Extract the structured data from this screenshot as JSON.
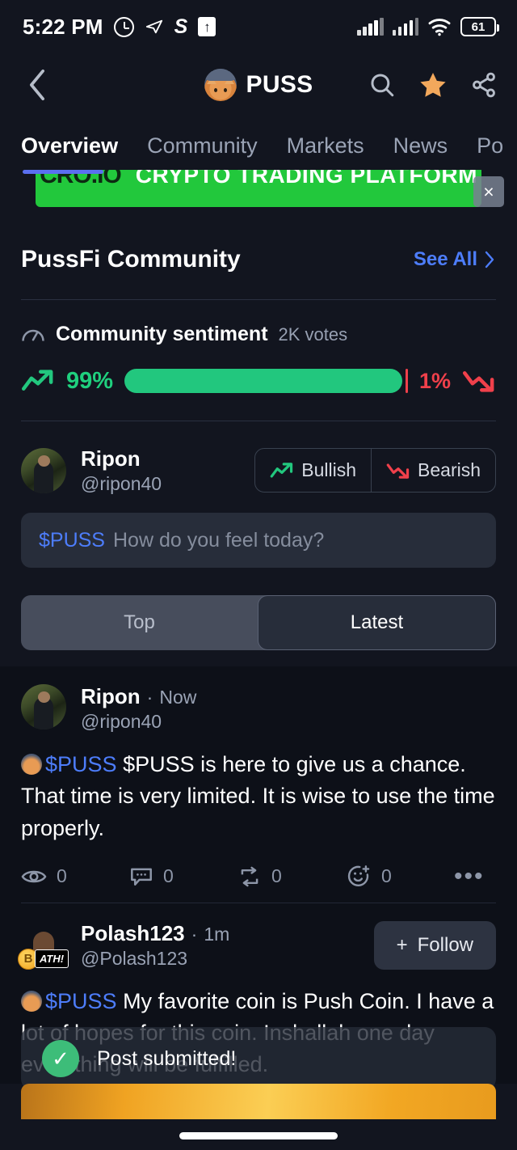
{
  "status_bar": {
    "time": "5:22 PM",
    "battery_level": "61",
    "icons": [
      "alarm-icon",
      "telegram-icon",
      "s-app-icon",
      "upload-icon",
      "signal-icon",
      "signal-icon",
      "wifi-icon",
      "battery-icon"
    ]
  },
  "header": {
    "back_icon": "chevron-left-icon",
    "coin_symbol": "PUSS",
    "avatar_icon": "puss-cat-avatar",
    "search_icon": "search-icon",
    "favorite_icon": "star-filled-icon",
    "share_icon": "share-icon",
    "favorite_color": "#f2a85c"
  },
  "tabs": [
    {
      "label": "Overview",
      "active": true
    },
    {
      "label": "Community",
      "active": false
    },
    {
      "label": "Markets",
      "active": false
    },
    {
      "label": "News",
      "active": false
    },
    {
      "label": "Po",
      "active": false
    }
  ],
  "ad": {
    "logo": "CRO.IO",
    "text": "CRYPTO TRADING PLATFORM",
    "close_label": "×",
    "background": "#22c83c"
  },
  "community": {
    "title": "PussFi Community",
    "see_all": "See All",
    "see_all_chevron": "›",
    "sentiment": {
      "label": "Community sentiment",
      "votes": "2K votes",
      "bullish_pct": "99%",
      "bearish_pct": "1%",
      "bullish_value": 99,
      "bearish_value": 1,
      "bullish_color": "#22c77e",
      "bearish_color": "#f0404b"
    }
  },
  "composer": {
    "user_name": "Ripon",
    "user_handle": "@ripon40",
    "bullish_label": "Bullish",
    "bearish_label": "Bearish",
    "cashtag": "$PUSS",
    "placeholder": "How do you feel today?"
  },
  "feed_filter": {
    "options": [
      {
        "label": "Top",
        "active": false
      },
      {
        "label": "Latest",
        "active": true
      }
    ]
  },
  "posts": [
    {
      "name": "Ripon",
      "time": "Now",
      "time_sep": "·",
      "handle": "@ripon40",
      "cashtag": "$PUSS",
      "body": "$PUSS is here to give us a chance. That time is very limited.  It is wise to use the time properly.",
      "actions": {
        "views": "0",
        "comments": "0",
        "reposts": "0",
        "reactions": "0",
        "more": "•••"
      }
    },
    {
      "name": "Polash123",
      "time": "1m",
      "time_sep": "·",
      "handle": "@Polash123",
      "badge": "ATH!",
      "follow_label": "Follow",
      "follow_plus": "+",
      "cashtag": "$PUSS",
      "body": "My favorite coin is Push Coin.  I have a lot of hopes for this coin. Inshallah one day everything will be fulfilled."
    }
  ],
  "toast": {
    "message": "Post submitted!",
    "icon": "check-circle-icon",
    "icon_glyph": "✓",
    "color": "#3dbd79"
  }
}
